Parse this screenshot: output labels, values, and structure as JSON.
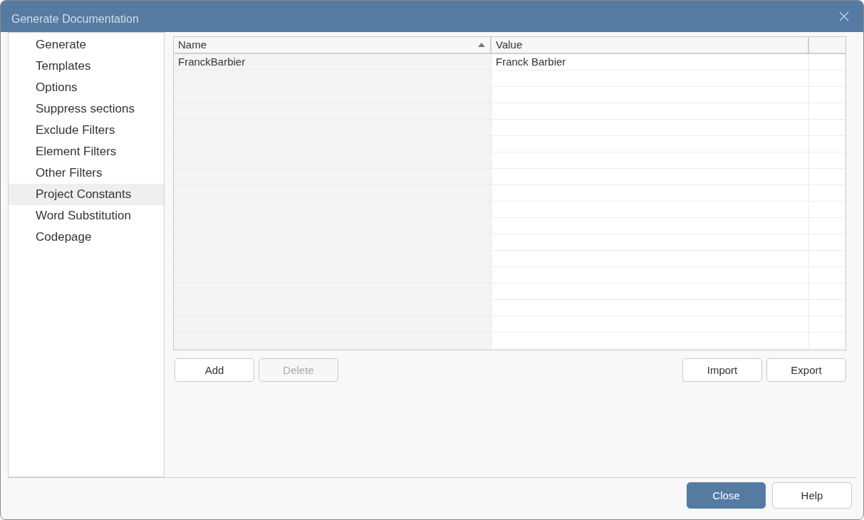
{
  "window": {
    "title": "Generate Documentation"
  },
  "sidebar": {
    "items": [
      {
        "label": "Generate",
        "selected": false
      },
      {
        "label": "Templates",
        "selected": false
      },
      {
        "label": "Options",
        "selected": false
      },
      {
        "label": "Suppress sections",
        "selected": false
      },
      {
        "label": "Exclude Filters",
        "selected": false
      },
      {
        "label": "Element Filters",
        "selected": false
      },
      {
        "label": "Other Filters",
        "selected": false
      },
      {
        "label": "Project Constants",
        "selected": true
      },
      {
        "label": "Word Substitution",
        "selected": false
      },
      {
        "label": "Codepage",
        "selected": false
      }
    ]
  },
  "table": {
    "columns": [
      {
        "label": "Name",
        "sorted": true
      },
      {
        "label": "Value",
        "sorted": false
      }
    ],
    "rows": [
      {
        "cells": [
          "FranckBarbier",
          "Franck Barbier"
        ]
      }
    ]
  },
  "table_buttons_left": [
    {
      "label": "Add",
      "disabled": false
    },
    {
      "label": "Delete",
      "disabled": true
    }
  ],
  "table_buttons_right": [
    {
      "label": "Import",
      "disabled": false
    },
    {
      "label": "Export",
      "disabled": false
    }
  ],
  "footer_buttons": [
    {
      "label": "Close",
      "kind": "primary"
    },
    {
      "label": "Help",
      "kind": "default"
    }
  ]
}
